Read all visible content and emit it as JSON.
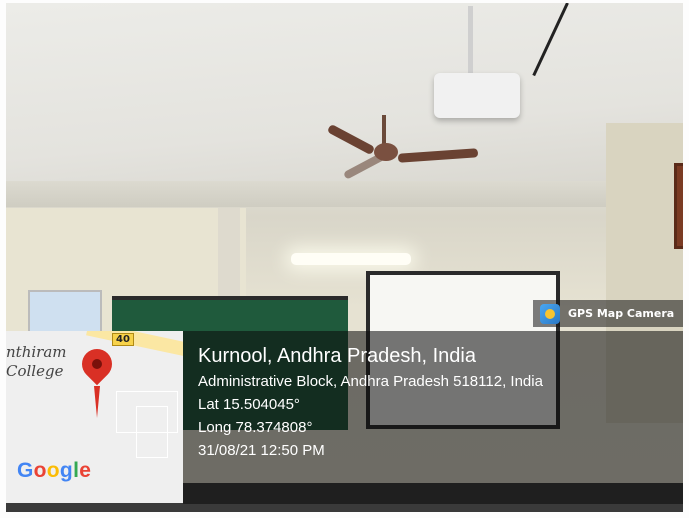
{
  "gps_app": {
    "name": "GPS Map Camera",
    "icon": "gps-camera-icon"
  },
  "map": {
    "road_number": "40",
    "place_label_line1": "nthiram",
    "place_label_line2": "College",
    "pin_icon": "map-pin-icon",
    "google_logo": [
      "G",
      "o",
      "o",
      "g",
      "l",
      "e"
    ],
    "google_colors": [
      "#4285F4",
      "#EA4335",
      "#FBBC05",
      "#4285F4",
      "#34A853",
      "#EA4335"
    ]
  },
  "location": {
    "city": "Kurnool, Andhra Pradesh, India",
    "address": "Administrative Block, Andhra Pradesh 518112, India",
    "lat": "Lat 15.504045°",
    "long": "Long 78.374808°",
    "datetime": "31/08/21 12:50 PM"
  }
}
